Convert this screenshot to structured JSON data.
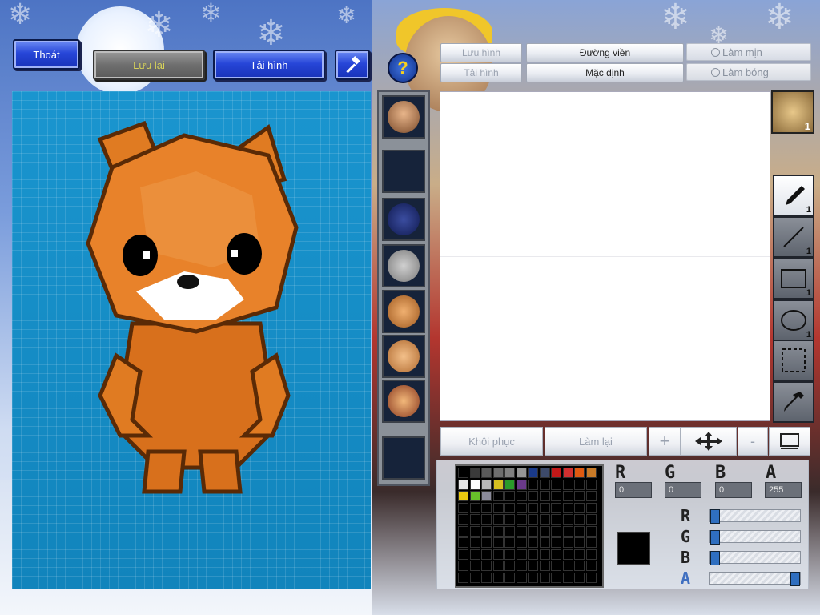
{
  "top_left": {
    "exit_label": "Thoát",
    "save_label": "Lưu lại",
    "load_label": "Tải hình"
  },
  "top_right": {
    "save_image_label": "Lưu hình",
    "load_image_label": "Tải hình",
    "outline_label": "Đường viền",
    "default_label": "Mặc định",
    "smooth_label": "Làm mịn",
    "shine_label": "Làm bóng"
  },
  "tools": {
    "brush_count": "1",
    "line_count": "1",
    "rect_count": "1",
    "ellipse_count": "1",
    "face_count": "1"
  },
  "actions": {
    "undo_label": "Khôi phục",
    "redo_label": "Làm lại"
  },
  "color": {
    "r_label": "R",
    "g_label": "G",
    "b_label": "B",
    "a_label": "A",
    "r_value": "0",
    "g_value": "0",
    "b_value": "0",
    "a_value": "255",
    "current": "#000000",
    "r_level": 0,
    "g_level": 0,
    "b_level": 0,
    "a_level": 1,
    "palette_row1": [
      "#000000",
      "#3a3a3a",
      "#5a5a5a",
      "#6e6e6e",
      "#808080",
      "#959595",
      "#1a3a8a",
      "#3d4a6a",
      "#c01818",
      "#d03030",
      "#e05a10",
      "#c87a28"
    ],
    "palette_row2": [
      "#e8e8e8",
      "#ffffff",
      "#b9b9b9",
      "#d6c020",
      "#2a9a2a",
      "#6a3a8a"
    ],
    "palette_row3": [
      "#e8c810",
      "#68c02a",
      "#8a8a9a"
    ]
  },
  "help_label": "?"
}
